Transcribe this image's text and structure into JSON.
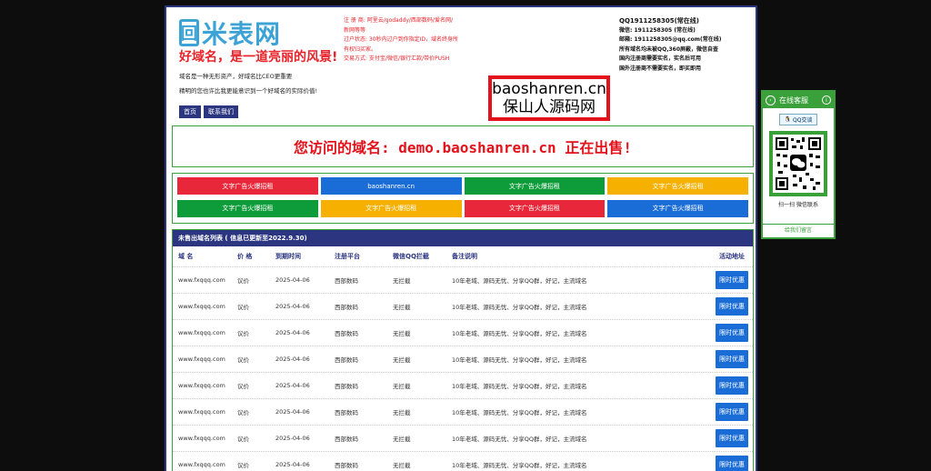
{
  "brand": {
    "logo_mark": "回",
    "logo_text": "米表网",
    "slogan": "好域名，是一道亮丽的风景!"
  },
  "intro": {
    "line1": "域名是一种无形资产，好域名比CEO更重要",
    "line2": "精明的您也许比我更能意识到一个好域名的实际价值!"
  },
  "nav": {
    "home": "首页",
    "contact": "联系我们"
  },
  "registrar_info": [
    "注 册 商: 阿里云/godaddy/西部数码/爱名网/",
    "新网等等",
    "过户状态: 30秒内过户到你指定ID，域名终身所",
    "有权归买家。",
    "交易方式: 支付宝/微信/银行汇款/带价PUSH"
  ],
  "contact_info": {
    "qq": "QQ1911258305(常在线)",
    "wechat": "微信: 1911258305 (常在线)",
    "email": "邮箱: 1911258305@qq.com(常在线)",
    "notes": [
      "所有域名均未被QQ,360屏蔽，微信自查",
      "国内注册商需要实名，实名后可用",
      "国外注册商不需要实名，即买即用"
    ]
  },
  "watermark": {
    "line1": "baoshanren.cn",
    "line2": "保山人源码网"
  },
  "sale_banner": "您访问的域名: demo.baoshanren.cn 正在出售!",
  "ads": [
    {
      "label": "文字广告火爆招租",
      "color": "#e8283a"
    },
    {
      "label": "baoshanren.cn",
      "color": "#1a6dd6"
    },
    {
      "label": "文字广告火爆招租",
      "color": "#0e9b3a"
    },
    {
      "label": "文字广告火爆招租",
      "color": "#f5b000"
    },
    {
      "label": "文字广告火爆招租",
      "color": "#0e9b3a"
    },
    {
      "label": "文字广告火爆招租",
      "color": "#f5b000"
    },
    {
      "label": "文字广告火爆招租",
      "color": "#e8283a"
    },
    {
      "label": "文字广告火爆招租",
      "color": "#1a6dd6"
    }
  ],
  "listing": {
    "title": "未售出域名列表 ( 信息已更新至2022.9.30)",
    "headers": [
      "域 名",
      "价 格",
      "到期时间",
      "注册平台",
      "微信QQ拦截",
      "备注说明",
      "活动地址"
    ],
    "rows": [
      [
        "www.fxqqq.com",
        "议价",
        "2025-04-06",
        "西部数码",
        "无拦截",
        "10年老域、源码无忧、分享QQ群，好记，主流域名",
        "限时优惠"
      ],
      [
        "www.fxqqq.com",
        "议价",
        "2025-04-06",
        "西部数码",
        "无拦截",
        "10年老域、源码无忧、分享QQ群，好记，主流域名",
        "限时优惠"
      ],
      [
        "www.fxqqq.com",
        "议价",
        "2025-04-06",
        "西部数码",
        "无拦截",
        "10年老域、源码无忧、分享QQ群，好记，主流域名",
        "限时优惠"
      ],
      [
        "www.fxqqq.com",
        "议价",
        "2025-04-06",
        "西部数码",
        "无拦截",
        "10年老域、源码无忧、分享QQ群，好记，主流域名",
        "限时优惠"
      ],
      [
        "www.fxqqq.com",
        "议价",
        "2025-04-06",
        "西部数码",
        "无拦截",
        "10年老域、源码无忧、分享QQ群，好记，主流域名",
        "限时优惠"
      ],
      [
        "www.fxqqq.com",
        "议价",
        "2025-04-06",
        "西部数码",
        "无拦截",
        "10年老域、源码无忧、分享QQ群，好记，主流域名",
        "限时优惠"
      ],
      [
        "www.fxqqq.com",
        "议价",
        "2025-04-06",
        "西部数码",
        "无拦截",
        "10年老域、源码无忧、分享QQ群，好记，主流域名",
        "限时优惠"
      ],
      [
        "www.fxqqq.com",
        "议价",
        "2025-04-06",
        "西部数码",
        "无拦截",
        "10年老域、源码无忧、分享QQ群，好记，主流域名",
        "限时优惠"
      ]
    ]
  },
  "side_panel": {
    "title": "在线客服",
    "qq_button": "QQ交谈",
    "scan_text": "扫一扫 微信联系",
    "footer": "给我们留言"
  }
}
